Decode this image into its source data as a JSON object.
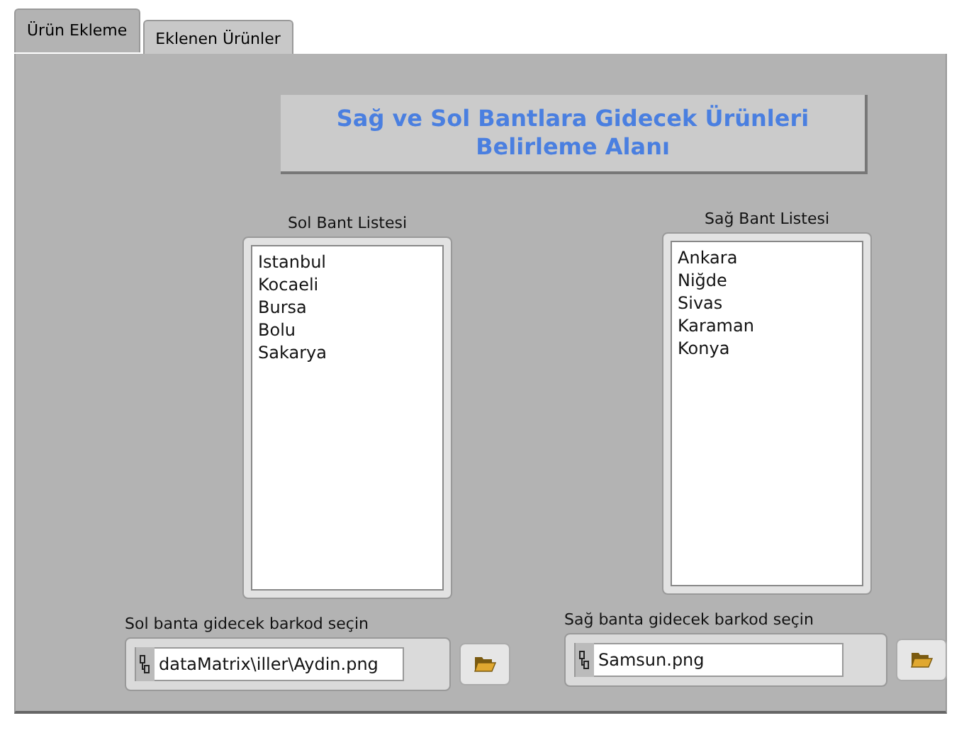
{
  "tabs": [
    {
      "label": "Ürün Ekleme",
      "selected": true
    },
    {
      "label": "Eklenen Ürünler",
      "selected": false
    }
  ],
  "title": [
    "Sağ ve Sol Bantlara Gidecek Ürünleri",
    "Belirleme Alanı"
  ],
  "lists": [
    {
      "label": "Sol Bant Listesi",
      "items": [
        "Istanbul",
        "Kocaeli",
        "Bursa",
        "Bolu",
        "Sakarya"
      ]
    },
    {
      "label": "Sağ Bant Listesi",
      "items": [
        "Ankara",
        "Niğde",
        "Sivas",
        "Karaman",
        "Konya"
      ]
    }
  ],
  "paths": [
    {
      "label": "Sol banta gidecek barkod seçin",
      "value": "dataMatrix\\iller\\Aydin.png"
    },
    {
      "label": "Sağ banta gidecek barkod seçin",
      "value": "Samsun.png"
    }
  ]
}
